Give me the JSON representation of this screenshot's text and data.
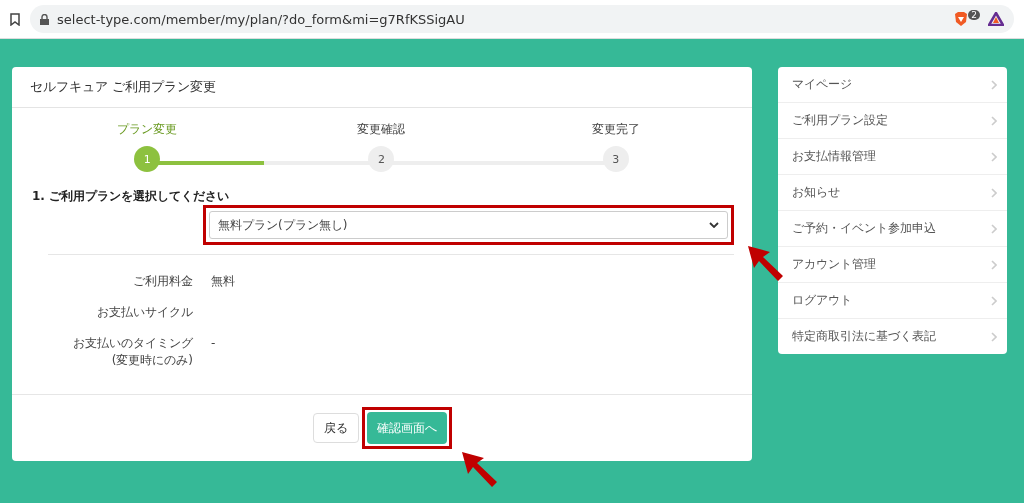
{
  "browser": {
    "url": "select-type.com/member/my/plan/?do_form&mi=g7RfKSSigAU",
    "badge": "2"
  },
  "card": {
    "title": "セルフキュア ご利用プラン変更",
    "steps": [
      {
        "label": "プラン変更",
        "number": "1",
        "selected": true
      },
      {
        "label": "変更確認",
        "number": "2",
        "selected": false
      },
      {
        "label": "変更完了",
        "number": "3",
        "selected": false
      }
    ],
    "question": "1. ご利用プランを選択してください",
    "plan_select": {
      "value": "無料プラン(プラン無し)"
    },
    "details": [
      {
        "label": "ご利用料金",
        "value": "無料"
      },
      {
        "label": "お支払いサイクル"
      },
      {
        "label": "お支払いのタイミング",
        "note": "(変更時にのみ)",
        "value": "-"
      }
    ],
    "buttons": {
      "back": "戻る",
      "confirm": "確認画面へ"
    }
  },
  "sidebar": {
    "items": [
      {
        "label": "マイページ"
      },
      {
        "label": "ご利用プラン設定"
      },
      {
        "label": "お支払情報管理"
      },
      {
        "label": "お知らせ"
      },
      {
        "label": "ご予約・イベント参加申込"
      },
      {
        "label": "アカウント管理"
      },
      {
        "label": "ログアウト"
      },
      {
        "label": "特定商取引法に基づく表記"
      }
    ]
  }
}
